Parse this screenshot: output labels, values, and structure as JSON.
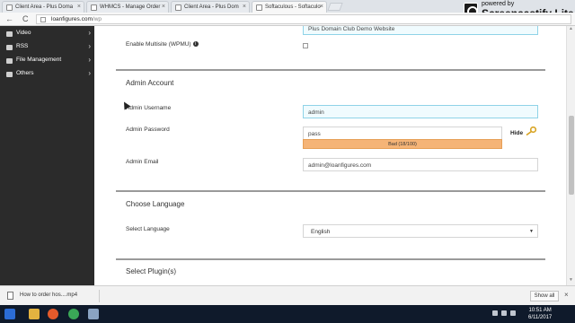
{
  "browser": {
    "tabs": [
      {
        "label": "Client Area - Plus Doma",
        "active": false
      },
      {
        "label": "WHMCS - Manage Order",
        "active": false
      },
      {
        "label": "Client Area - Plus Dom",
        "active": false
      },
      {
        "label": "Softaculous - Softaculo",
        "active": true
      }
    ],
    "url_domain": "loanfigures.com",
    "url_path": "/wp",
    "back": "←",
    "reload": "C",
    "tab_close": "×"
  },
  "watermark": {
    "small": "powered by",
    "big": "Screencastify Lite"
  },
  "sidebar": {
    "items": [
      {
        "label": "Video",
        "icon": "video-icon"
      },
      {
        "label": "RSS",
        "icon": "rss-icon"
      },
      {
        "label": "File Management",
        "icon": "folder-icon"
      },
      {
        "label": "Others",
        "icon": "others-icon"
      }
    ],
    "chevron": "›"
  },
  "form": {
    "site_description_value": "Plus Domain Club Demo Website",
    "multisite_label": "Enable Multisite (WPMU)",
    "multisite_checked": false,
    "info_glyph": "i",
    "admin_section_title": "Admin Account",
    "admin_username_label": "Admin Username",
    "admin_username_value": "admin",
    "admin_password_label": "Admin Password",
    "admin_password_value": "pass",
    "password_strength": "Bad (18/100)",
    "hide_label": "Hide",
    "admin_email_label": "Admin Email",
    "admin_email_value": "admin@loanfigures.com",
    "language_section_title": "Choose Language",
    "select_language_label": "Select Language",
    "select_language_value": "English",
    "plugins_section_title": "Select Plugin(s)"
  },
  "downloads": {
    "filename": "How to order hos....mp4",
    "show_all": "Show all",
    "close": "×"
  },
  "taskbar": {
    "time": "10:51 AM",
    "date": "6/11/2017"
  },
  "colors": {
    "sidebar_bg": "#2b2b2b",
    "strength_bar": "#f5b477",
    "focus_border": "#8fd3e8",
    "taskbar_bg": "#0f1a2b"
  }
}
